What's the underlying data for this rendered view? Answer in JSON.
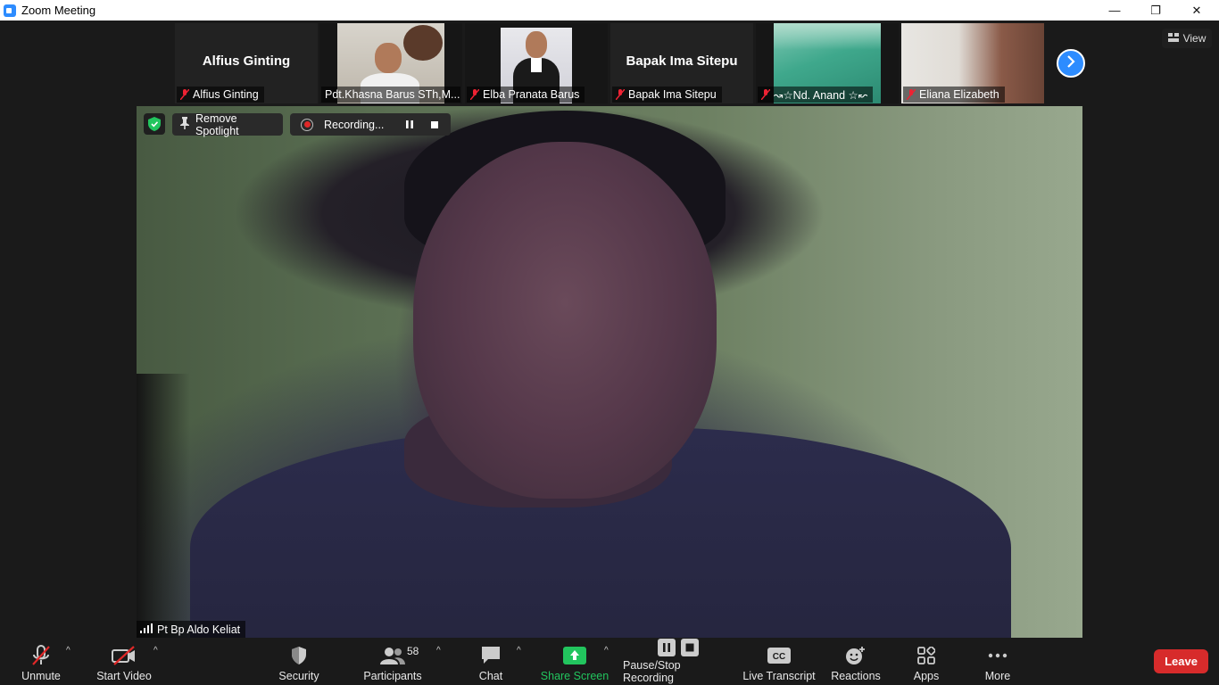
{
  "window": {
    "title": "Zoom Meeting",
    "controls": {
      "minimize": "—",
      "restore": "❐",
      "close": "✕"
    }
  },
  "view_button": {
    "label": "View"
  },
  "thumbnails": [
    {
      "display_name": "Alfius Ginting",
      "caption": "Alfius Ginting",
      "video_on": false
    },
    {
      "display_name": "",
      "caption": "Pdt.Khasna Barus STh,M...",
      "video_on": true
    },
    {
      "display_name": "",
      "caption": "Elba Pranata Barus",
      "video_on": true
    },
    {
      "display_name": "Bapak Ima Sitepu",
      "caption": "Bapak Ima Sitepu",
      "video_on": false
    },
    {
      "display_name": "",
      "caption": "↝☆Nd. Anand ☆↜",
      "video_on": true
    },
    {
      "display_name": "",
      "caption": "Eliana Elizabeth",
      "video_on": true
    }
  ],
  "spotlight": {
    "remove_label": "Remove Spotlight",
    "recording_label": "Recording...",
    "speaker_name": "Pt Bp Aldo Keliat"
  },
  "toolbar": {
    "unmute": "Unmute",
    "start_video": "Start Video",
    "security": "Security",
    "participants": "Participants",
    "participants_count": "58",
    "chat": "Chat",
    "share_screen": "Share Screen",
    "pause_stop_recording": "Pause/Stop Recording",
    "live_transcript": "Live Transcript",
    "reactions": "Reactions",
    "apps": "Apps",
    "more": "More",
    "leave": "Leave"
  },
  "colors": {
    "accent": "#2d8cff",
    "share_green": "#22c55e",
    "leave_red": "#d72b2b",
    "rec_red": "#e02828"
  }
}
